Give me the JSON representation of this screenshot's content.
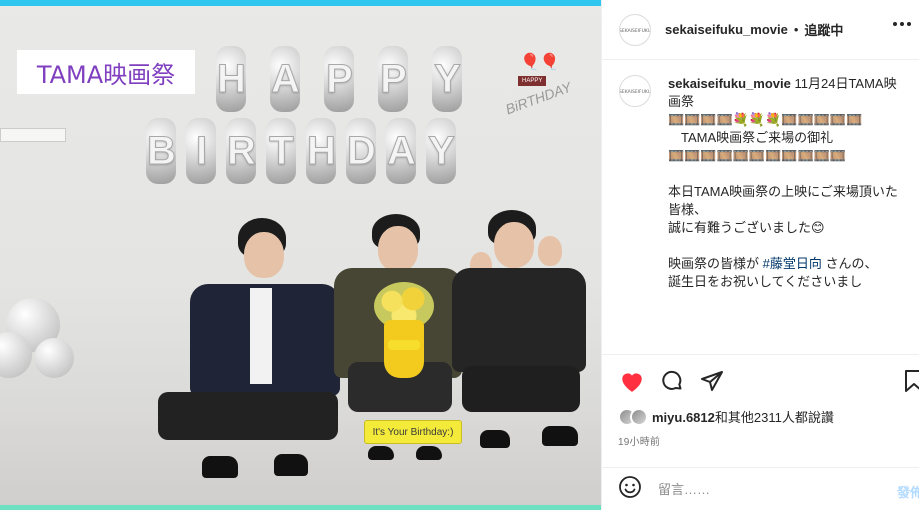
{
  "photo": {
    "overlay_label": "TAMA映画祭",
    "balloon_line1": [
      "H",
      "A",
      "P",
      "P",
      "Y"
    ],
    "balloon_line2": [
      "B",
      "I",
      "R",
      "T",
      "H",
      "D",
      "A",
      "Y"
    ],
    "sticker_text": "It's Your Birthday:)",
    "colors": {
      "top_strip": "#2fc6ef",
      "bottom_strip": "#6ee0c2",
      "label_text": "#7f3fbf"
    }
  },
  "header": {
    "username": "sekaiseifuku_movie",
    "separator": "•",
    "follow_status": "追蹤中",
    "more_icon": "more-horizontal-icon"
  },
  "caption": {
    "username": "sekaiseifuku_movie",
    "lines": [
      "11月24日TAMA映画祭",
      "🎞️🎞️🎞️🎞️💐💐💐🎞️🎞️🎞️🎞️🎞️",
      "　TAMA映画祭ご来場の御礼",
      "🎞️🎞️🎞️🎞️🎞️🎞️🎞️🎞️🎞️🎞️🎞️",
      "",
      "本日TAMA映画祭の上映にご来場頂いた皆様、",
      "誠に有難うございました😊",
      "",
      "映画祭の皆様が",
      "誕生日をお祝いしてくださいまし"
    ],
    "hashtag": "#藤堂日向",
    "after_hashtag": " さんの、"
  },
  "actions": {
    "like_icon": "heart-filled-icon",
    "comment_icon": "comment-icon",
    "share_icon": "paper-plane-icon",
    "save_icon": "bookmark-icon",
    "like_color": "#ff3040"
  },
  "likes": {
    "user": "miyu.6812",
    "rest": "和其他2311人都說讚"
  },
  "time": "19小時前",
  "comment": {
    "placeholder": "留言……",
    "post_label": "發佈",
    "emoji_icon": "smiley-icon"
  }
}
